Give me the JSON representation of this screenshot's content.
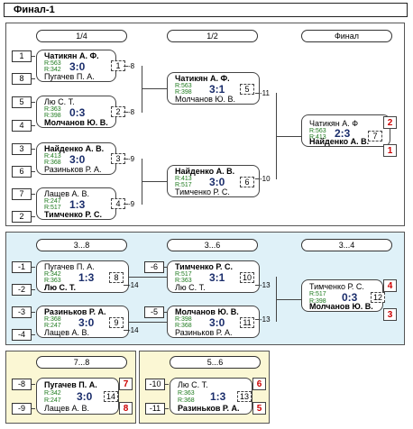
{
  "title": "Финал-1",
  "rounds": {
    "r14": "1/4",
    "r12": "1/2",
    "final": "Финал",
    "p38": "3...8",
    "p36": "3...6",
    "p34": "3...4",
    "p78": "7...8",
    "p56": "5...6"
  },
  "seeds": {
    "s1": "1",
    "s8": "8",
    "s5": "5",
    "s4": "4",
    "s3": "3",
    "s6": "6",
    "s7": "7",
    "s2": "2",
    "lm1": "-1",
    "lm2": "-2",
    "lm3": "-3",
    "lm4": "-4",
    "lm6": "-6",
    "lm5": "-5",
    "lm8": "-8",
    "lm9": "-9",
    "lm10": "-10",
    "lm11": "-11"
  },
  "refs": {
    "to8": "-8",
    "to9": "-9",
    "to10": "-10",
    "to11": "-11",
    "to13": "-13",
    "to14": "-14"
  },
  "matches": {
    "m1": {
      "top": "Чатикян А. Ф.",
      "top_r": "R:563",
      "bot": "Пугачев П. А.",
      "bot_r": "R:342",
      "score": "3:0",
      "no": "1"
    },
    "m2": {
      "top": "Лю С. Т.",
      "top_r": "R:363",
      "bot": "Молчанов Ю. В.",
      "bot_r": "R:398",
      "score": "0:3",
      "no": "2"
    },
    "m3": {
      "top": "Найденко А. В.",
      "top_r": "R:413",
      "bot": "Разиньков Р. А.",
      "bot_r": "R:368",
      "score": "3:0",
      "no": "3"
    },
    "m4": {
      "top": "Лащев А. В.",
      "top_r": "R:247",
      "bot": "Тимченко Р. С.",
      "bot_r": "R:517",
      "score": "1:3",
      "no": "4"
    },
    "m5": {
      "top": "Чатикян А. Ф.",
      "top_r": "R:563",
      "bot": "Молчанов Ю. В.",
      "bot_r": "R:398",
      "score": "3:1",
      "no": "5"
    },
    "m6": {
      "top": "Найденко А. В.",
      "top_r": "R:413",
      "bot": "Тимченко Р. С.",
      "bot_r": "R:517",
      "score": "3:0",
      "no": "6"
    },
    "m7": {
      "top": "Чатикян А. Ф",
      "top_r": "R:563",
      "bot": "Найденко А. В.",
      "bot_r": "R:413",
      "score": "2:3",
      "no": "7",
      "pos_top": "2",
      "pos_bot": "1"
    },
    "m8": {
      "top": "Пугачев П. А.",
      "top_r": "R:342",
      "bot": "Лю С. Т.",
      "bot_r": "R:363",
      "score": "1:3",
      "no": "8"
    },
    "m9": {
      "top": "Разиньков Р. А.",
      "top_r": "R:368",
      "bot": "Лащев А. В.",
      "bot_r": "R:247",
      "score": "3:0",
      "no": "9"
    },
    "m10": {
      "top": "Тимченко Р. С.",
      "top_r": "R:517",
      "bot": "Лю С. Т.",
      "bot_r": "R:363",
      "score": "3:1",
      "no": "10"
    },
    "m11": {
      "top": "Молчанов Ю. В.",
      "top_r": "R:398",
      "bot": "Разиньков Р. А.",
      "bot_r": "R:368",
      "score": "3:0",
      "no": "11"
    },
    "m12": {
      "top": "Тимченко Р. С.",
      "top_r": "R:517",
      "bot": "Молчанов Ю. В.",
      "bot_r": "R:398",
      "score": "0:3",
      "no": "12",
      "pos_top": "4",
      "pos_bot": "3"
    },
    "m13": {
      "top": "Лю С. Т.",
      "top_r": "R:363",
      "bot": "Разиньков Р. А.",
      "bot_r": "R:368",
      "score": "1:3",
      "no": "13",
      "pos_top": "6",
      "pos_bot": "5"
    },
    "m14": {
      "top": "Пугачев П. А.",
      "top_r": "R:342",
      "bot": "Лащев А. В.",
      "bot_r": "R:247",
      "score": "3:0",
      "no": "14",
      "pos_top": "7",
      "pos_bot": "8"
    }
  },
  "colors": {
    "panel_main": "#ffffff",
    "panel_blue": "#dff1f8",
    "panel_yellow": "#fbf7d4",
    "score": "#1a2d6b",
    "rating": "#1d7a1d",
    "place": "#cc0000"
  }
}
